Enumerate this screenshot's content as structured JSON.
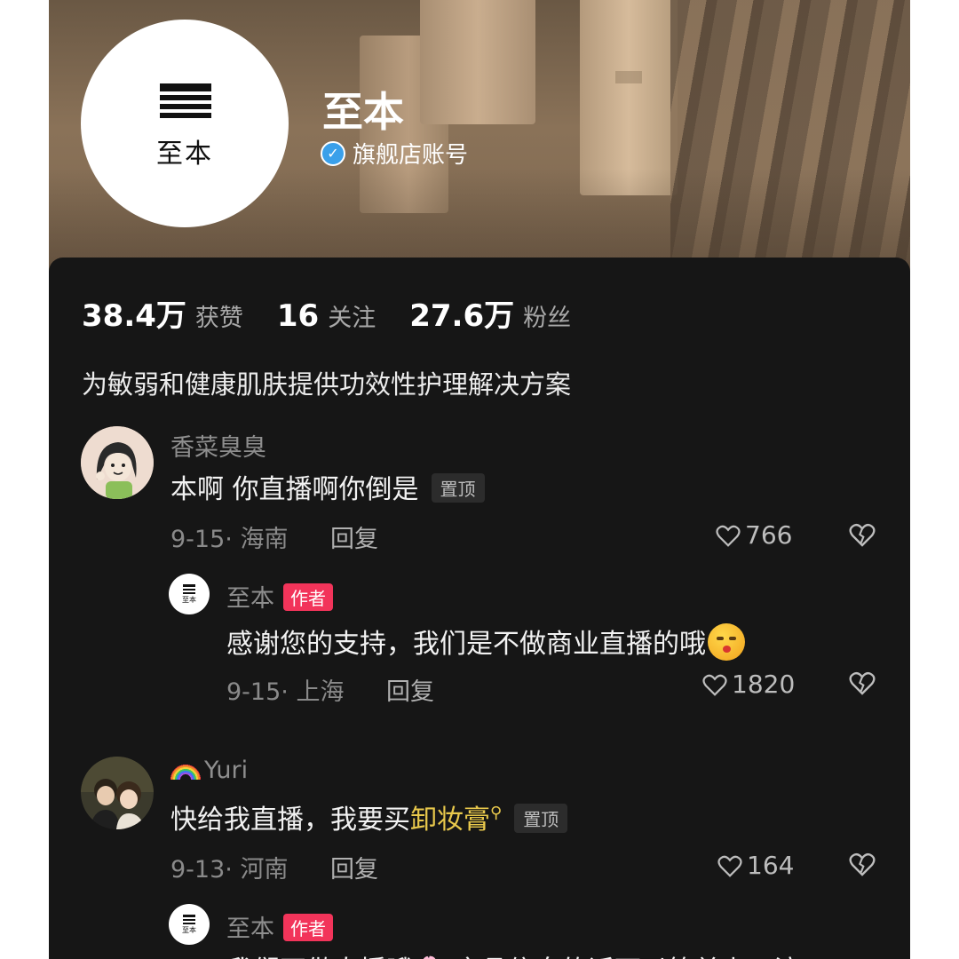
{
  "profile": {
    "name": "至本",
    "logo_text": "至本",
    "verified_label": "旗舰店账号",
    "stats": [
      {
        "value": "38.4万",
        "label": "获赞"
      },
      {
        "value": "16",
        "label": "关注"
      },
      {
        "value": "27.6万",
        "label": "粉丝"
      }
    ],
    "bio": "为敏弱和健康肌肤提供功效性护理解决方案"
  },
  "comments": [
    {
      "user": "香菜臭臭",
      "text": "本啊  你直播啊你倒是",
      "pinned_label": "置顶",
      "date_location": "9-15· 海南",
      "reply_label": "回复",
      "likes": "766",
      "replies": [
        {
          "user": "至本",
          "badge": "作者",
          "text": "感谢您的支持，我们是不做商业直播的哦",
          "emoji": "kiss-face-emoji",
          "date_location": "9-15· 上海",
          "reply_label": "回复",
          "likes": "1820"
        }
      ]
    },
    {
      "user": "Yuri",
      "text_prefix": "快给我直播，我要买",
      "text_highlight": "卸妆膏",
      "pinned_label": "置顶",
      "date_location": "9-13· 河南",
      "reply_label": "回复",
      "likes": "164",
      "replies": [
        {
          "user": "至本",
          "badge": "作者",
          "text": "我们不做直播哦🌸 产品信息的话可以简单上一滴"
        }
      ]
    }
  ],
  "colors": {
    "background": "#161616",
    "author_badge": "#f2345a",
    "keyword_highlight": "#e9c94c",
    "verified": "#3aa0ea"
  }
}
